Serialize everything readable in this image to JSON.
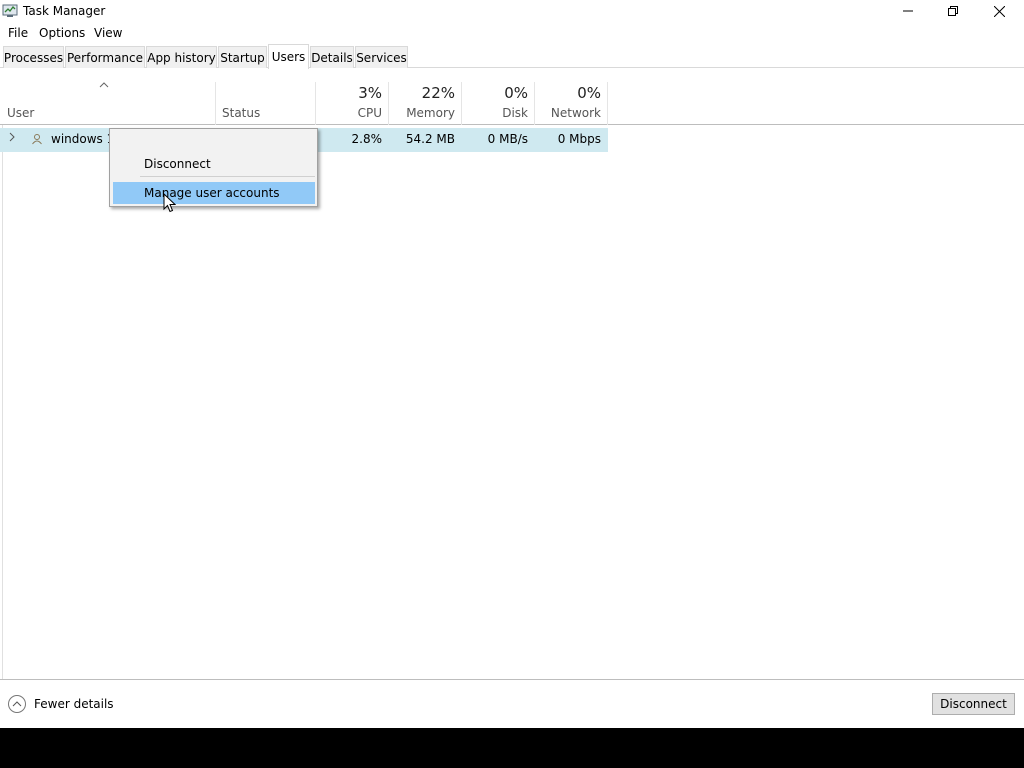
{
  "window": {
    "title": "Task Manager",
    "controls": [
      "minimize",
      "restore",
      "close"
    ]
  },
  "menu": {
    "items": [
      "File",
      "Options",
      "View"
    ]
  },
  "tabs": {
    "items": [
      "Processes",
      "Performance",
      "App history",
      "Startup",
      "Users",
      "Details",
      "Services"
    ],
    "active": "Users"
  },
  "columns": {
    "user": "User",
    "status": "Status",
    "cpu": {
      "pct": "3%",
      "label": "CPU"
    },
    "memory": {
      "pct": "22%",
      "label": "Memory"
    },
    "disk": {
      "pct": "0%",
      "label": "Disk"
    },
    "network": {
      "pct": "0%",
      "label": "Network"
    }
  },
  "rows": [
    {
      "user": "windows 10",
      "status": "",
      "cpu": "2.8%",
      "memory": "54.2 MB",
      "disk": "0 MB/s",
      "network": "0 Mbps"
    }
  ],
  "context_menu": {
    "items": [
      {
        "label": "Disconnect",
        "highlighted": false
      },
      {
        "label": "Manage user accounts",
        "highlighted": true
      }
    ]
  },
  "footer": {
    "fewer_details": "Fewer details",
    "disconnect_button": "Disconnect"
  },
  "colors": {
    "row_highlight": "#cfe9f0",
    "menu_highlight": "#91c9f7"
  },
  "icons": {
    "app": "task-manager-icon",
    "user": "user-icon",
    "expand": "chevron-right-icon",
    "sort": "chevron-up-icon",
    "fewer": "chevron-up-circle-icon"
  }
}
